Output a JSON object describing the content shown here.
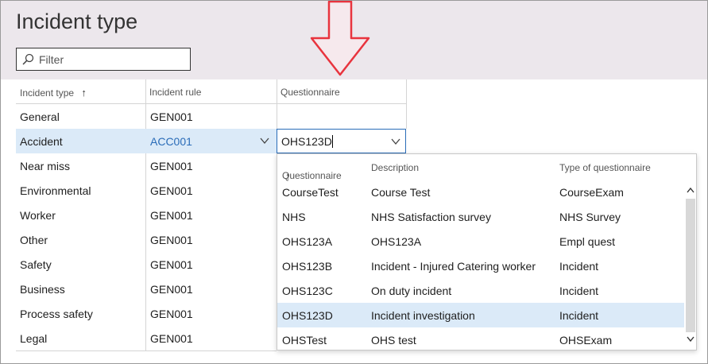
{
  "page": {
    "title": "Incident type"
  },
  "filter": {
    "placeholder": "Filter",
    "value": ""
  },
  "grid": {
    "headers": {
      "incident_type": "Incident type",
      "incident_rule": "Incident rule",
      "questionnaire": "Questionnaire"
    },
    "sort_indicator": "↑",
    "rows": [
      {
        "type": "General",
        "rule": "GEN001"
      },
      {
        "type": "Accident",
        "rule": "ACC001"
      },
      {
        "type": "Near miss",
        "rule": "GEN001"
      },
      {
        "type": "Environmental",
        "rule": "GEN001"
      },
      {
        "type": "Worker",
        "rule": "GEN001"
      },
      {
        "type": "Other",
        "rule": "GEN001"
      },
      {
        "type": "Safety",
        "rule": "GEN001"
      },
      {
        "type": "Business",
        "rule": "GEN001"
      },
      {
        "type": "Process safety",
        "rule": "GEN001"
      },
      {
        "type": "Legal",
        "rule": "GEN001"
      }
    ],
    "selected_questionnaire_value": "OHS123D"
  },
  "dropdown": {
    "headers": {
      "questionnaire": "Questionnaire",
      "description": "Description",
      "type": "Type of questionnaire"
    },
    "sort_indicator": "↑",
    "rows": [
      {
        "q": "CourseTest",
        "desc": "Course Test",
        "type": "CourseExam"
      },
      {
        "q": "NHS",
        "desc": "NHS Satisfaction survey",
        "type": "NHS Survey"
      },
      {
        "q": "OHS123A",
        "desc": "OHS123A",
        "type": "Empl quest"
      },
      {
        "q": "OHS123B",
        "desc": "Incident - Injured Catering worker",
        "type": "Incident"
      },
      {
        "q": "OHS123C",
        "desc": "On duty incident",
        "type": "Incident"
      },
      {
        "q": "OHS123D",
        "desc": "Incident investigation",
        "type": "Incident"
      },
      {
        "q": "OHSTest",
        "desc": "OHS test",
        "type": "OHSExam"
      }
    ]
  },
  "colors": {
    "selection": "#dbeaf8",
    "accent": "#2a6cb8",
    "arrow": "#e8343e",
    "header_band": "#ece7ec"
  },
  "icons": {
    "filter": "search-icon",
    "arrow": "down-arrow-annotation-icon",
    "chevron": "chevron-down-icon"
  }
}
